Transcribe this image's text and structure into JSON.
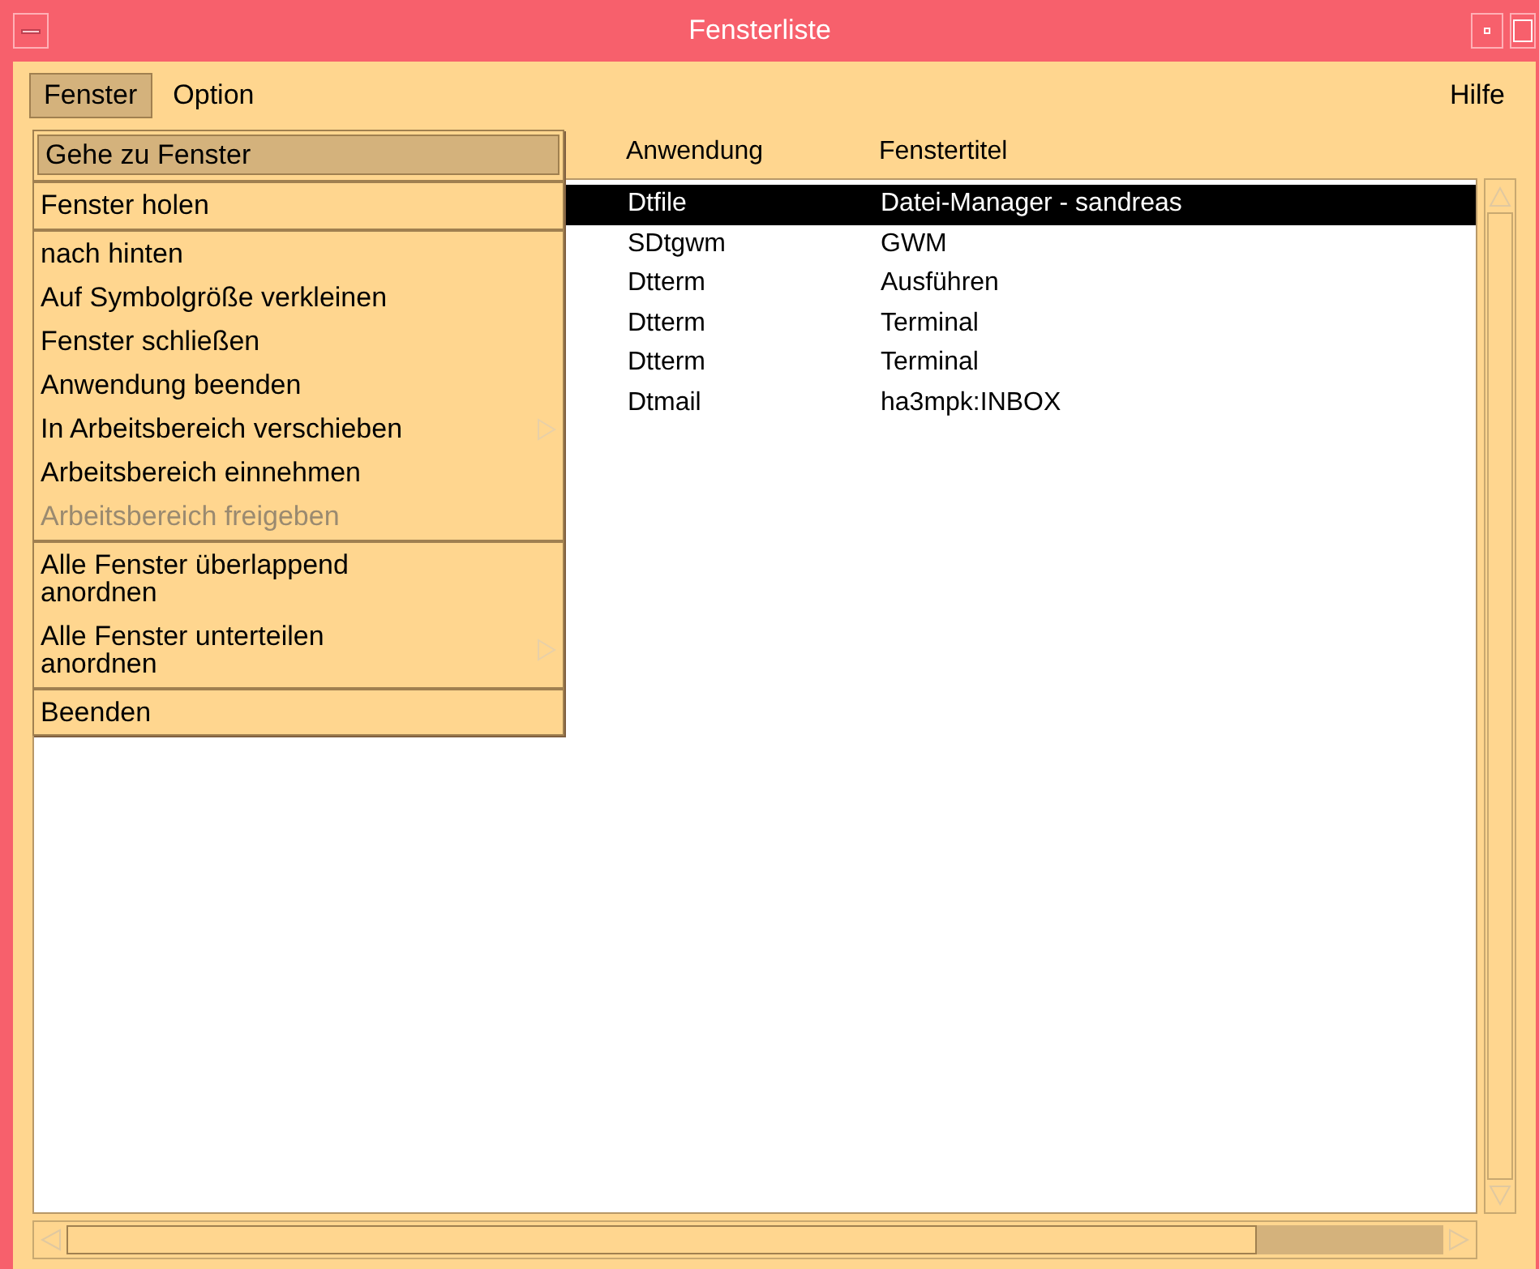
{
  "window": {
    "title": "Fensterliste"
  },
  "menubar": [
    {
      "label": "Fenster",
      "selected": true
    },
    {
      "label": "Option",
      "selected": false
    },
    {
      "label": "Hilfe",
      "selected": false
    }
  ],
  "menu": {
    "items": [
      {
        "label": "Gehe zu Fenster",
        "selected": true,
        "disabled": false,
        "submenu": false,
        "separator_before": false
      },
      {
        "label": "Fenster holen",
        "selected": false,
        "disabled": false,
        "submenu": false,
        "separator_before": true
      },
      {
        "label": "nach hinten",
        "selected": false,
        "disabled": false,
        "submenu": false,
        "separator_before": true
      },
      {
        "label": "Auf Symbolgröße verkleinen",
        "selected": false,
        "disabled": false,
        "submenu": false,
        "separator_before": false
      },
      {
        "label": "Fenster schließen",
        "selected": false,
        "disabled": false,
        "submenu": false,
        "separator_before": false
      },
      {
        "label": "Anwendung beenden",
        "selected": false,
        "disabled": false,
        "submenu": false,
        "separator_before": false
      },
      {
        "label": "In Arbeitsbereich verschieben",
        "selected": false,
        "disabled": false,
        "submenu": true,
        "separator_before": false
      },
      {
        "label": "Arbeitsbereich einnehmen",
        "selected": false,
        "disabled": false,
        "submenu": false,
        "separator_before": false
      },
      {
        "label": "Arbeitsbereich freigeben",
        "selected": false,
        "disabled": true,
        "submenu": false,
        "separator_before": false
      },
      {
        "label": "Alle Fenster überlappend\nanordnen",
        "selected": false,
        "disabled": false,
        "submenu": false,
        "separator_before": true
      },
      {
        "label": "Alle Fenster unterteilen\nanordnen",
        "selected": false,
        "disabled": false,
        "submenu": true,
        "separator_before": false
      },
      {
        "label": "Beenden",
        "selected": false,
        "disabled": false,
        "submenu": false,
        "separator_before": true
      }
    ]
  },
  "table": {
    "columns": [
      "Anwendung",
      "Fenstertitel"
    ],
    "rows": [
      {
        "application": "Dtfile",
        "title": "Datei-Manager - sandreas",
        "selected": true
      },
      {
        "application": "SDtgwm",
        "title": "GWM",
        "selected": false
      },
      {
        "application": "Dtterm",
        "title": "Ausführen",
        "selected": false
      },
      {
        "application": "Dtterm",
        "title": "Terminal",
        "selected": false
      },
      {
        "application": "Dtterm",
        "title": "Terminal",
        "selected": false
      },
      {
        "application": "Dtmail",
        "title": "ha3mpk:INBOX",
        "selected": false
      }
    ]
  }
}
